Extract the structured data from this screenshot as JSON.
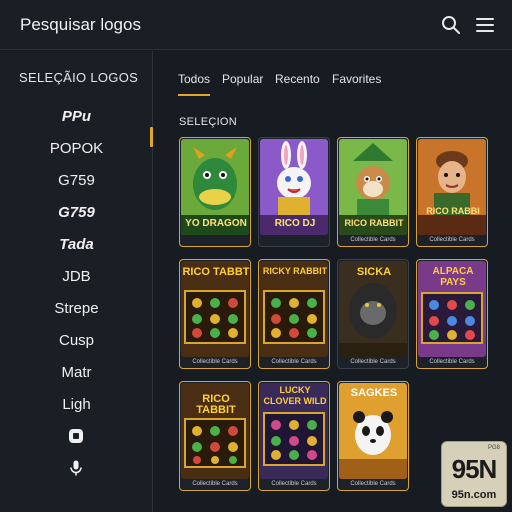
{
  "header": {
    "title": "Pesquisar logos",
    "search_icon": "search-icon",
    "menu_icon": "menu-icon"
  },
  "sidebar": {
    "heading": "SELEÇÃIO LOGOS",
    "items": [
      {
        "label": "PPu"
      },
      {
        "label": "POPOK"
      },
      {
        "label": "G759"
      },
      {
        "label": "G759"
      },
      {
        "label": "Tada"
      },
      {
        "label": "JDB"
      },
      {
        "label": "Strepe"
      },
      {
        "label": "Cusp"
      },
      {
        "label": "Matr"
      },
      {
        "label": "Ligh"
      }
    ],
    "extra_icons": [
      "square-circle-icon",
      "microphone-icon"
    ]
  },
  "tabs": [
    "Todos",
    "Popular",
    "Recento",
    "Favorites"
  ],
  "section": {
    "title": "SELEÇION"
  },
  "cards": [
    {
      "title": "YO DRAGON",
      "label": "",
      "theme": "#2f6b2a"
    },
    {
      "title": "RICO DJ",
      "label": "",
      "theme": "#5a3a8a"
    },
    {
      "title": "RICO RABBIT",
      "label": "Collectible Cards",
      "theme": "#3f7a3a"
    },
    {
      "title": "RICO RABBI",
      "label": "Collectible Cards",
      "theme": "#7a4a22"
    },
    {
      "title": "RICO TABBT",
      "label": "Collectible Cards",
      "theme": "#3a2a1a"
    },
    {
      "title": "RICKY RABBIT",
      "label": "Collectible Cards",
      "theme": "#3a2a1a"
    },
    {
      "title": "SICKA",
      "label": "Collectible Cards",
      "theme": "#2a2218"
    },
    {
      "title": "ALPACA PAYS",
      "label": "Collectible Cards",
      "theme": "#5a2a6a"
    },
    {
      "title": "RICO TABBIT",
      "label": "Collectible Cards",
      "theme": "#3a2a1a"
    },
    {
      "title": "LUCKY CLOVER WILD",
      "label": "Collectible Cards",
      "theme": "#3a2a5a"
    },
    {
      "title": "SAGKES",
      "label": "Collectible Cards",
      "theme": "#b87a1a"
    }
  ],
  "badge": {
    "small": "PG8",
    "big": "95N",
    "url": "95n.com"
  },
  "colors": {
    "accent": "#e3a52a",
    "background": "#171b22"
  }
}
